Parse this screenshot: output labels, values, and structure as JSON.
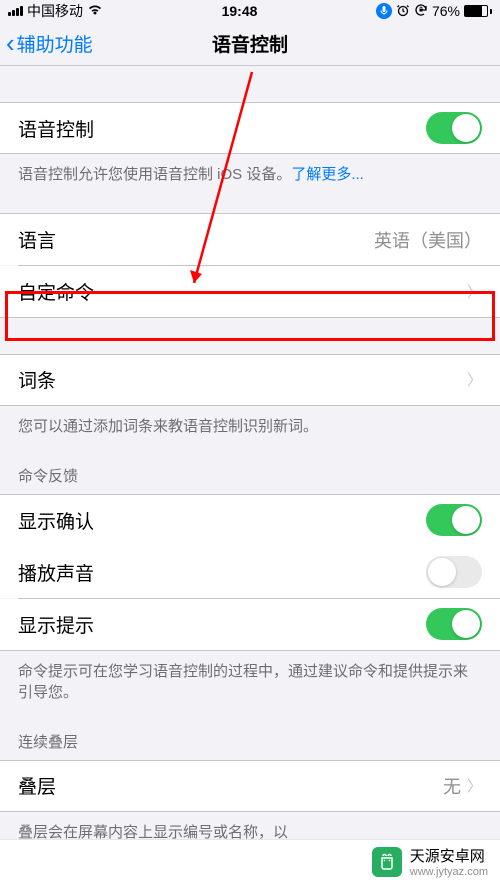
{
  "status": {
    "carrier": "中国移动",
    "time": "19:48",
    "battery": "76%"
  },
  "nav": {
    "back": "辅助功能",
    "title": "语音控制"
  },
  "voiceControl": {
    "label": "语音控制",
    "on": true,
    "footer": "语音控制允许您使用语音控制 iOS 设备。",
    "learnMore": "了解更多..."
  },
  "language": {
    "label": "语言",
    "value": "英语（美国）"
  },
  "customCommands": {
    "label": "自定命令"
  },
  "vocabulary": {
    "label": "词条",
    "footer": "您可以通过添加词条来教语音控制识别新词。"
  },
  "feedback": {
    "header": "命令反馈",
    "showConfirm": {
      "label": "显示确认",
      "on": true
    },
    "playSound": {
      "label": "播放声音",
      "on": false
    },
    "showHints": {
      "label": "显示提示",
      "on": true
    },
    "footer": "命令提示可在您学习语音控制的过程中，通过建议命令和提供提示来引导您。"
  },
  "overlay": {
    "header": "连续叠层",
    "label": "叠层",
    "value": "无",
    "footer": "叠层会在屏幕内容上显示编号或名称，以"
  },
  "watermark": {
    "name": "天源安卓网",
    "url": "www.jytyaz.com"
  }
}
